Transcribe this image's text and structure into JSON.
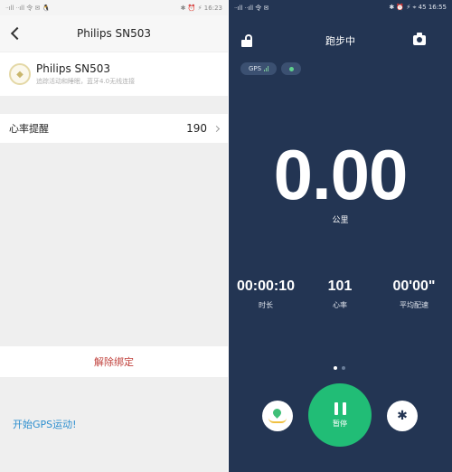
{
  "left_screen": {
    "status_bar": {
      "left": "ᐧᐧıll ᐧᐧıll 令 ✉ 🐧",
      "right": "✱ ⏰ ⚡ 16:23"
    },
    "nav": {
      "title": "Philips SN503"
    },
    "device": {
      "name": "Philips SN503",
      "description": "追踪活动和睡眠，蓝牙4.0无线连接"
    },
    "heart_rate_alert": {
      "label": "心率提醒",
      "value": "190"
    },
    "unbind_label": "解除绑定",
    "start_gps_label": "开始GPS运动!"
  },
  "right_screen": {
    "status_bar": {
      "left": "ᐧᐧıll ᐧᐧıll 令 ✉",
      "right": "✱ ⏰ ⚡ ⌖ 45 16:55"
    },
    "title": "跑步中",
    "gps_label": "GPS",
    "distance": "0.00",
    "distance_unit": "公里",
    "stats": [
      {
        "value": "00:00:10",
        "label": "时长"
      },
      {
        "value": "101",
        "label": "心率"
      },
      {
        "value": "00'00\"",
        "label": "平均配速"
      }
    ],
    "pause_label": "暂停",
    "page_indicator": {
      "current": 1,
      "total": 2
    },
    "colors": {
      "background": "#233553",
      "accent": "#21bd76"
    },
    "icons": {
      "lock": "unlock-icon",
      "camera": "camera-icon",
      "map": "map-pin-icon",
      "settings": "gear-icon"
    }
  }
}
